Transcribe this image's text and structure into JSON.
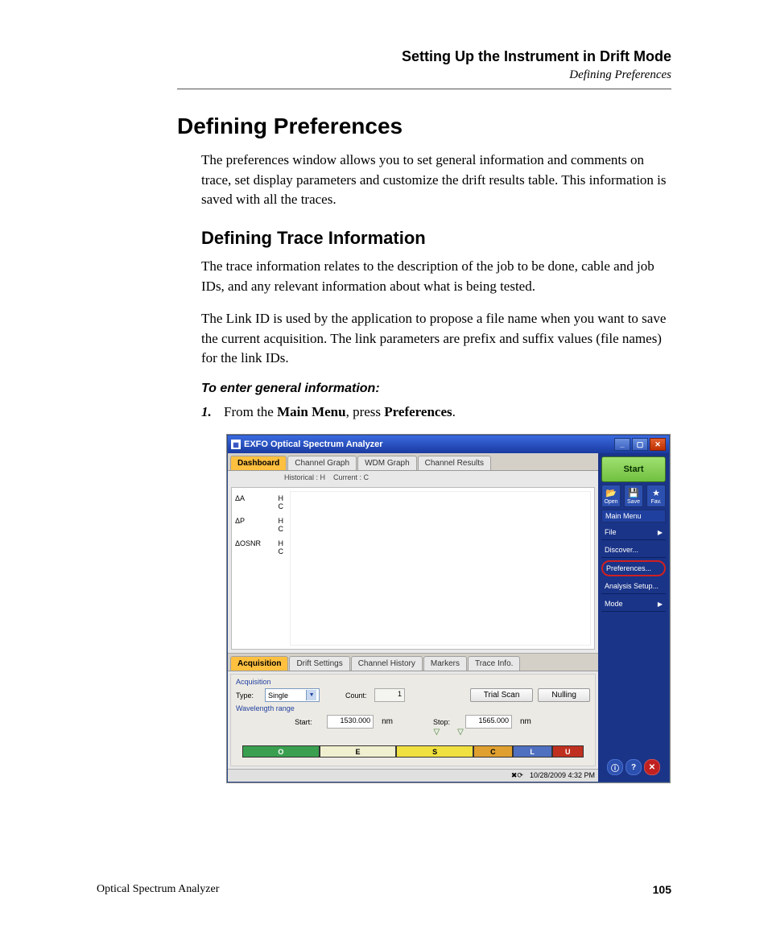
{
  "header": {
    "chapter": "Setting Up the Instrument in Drift Mode",
    "subchapter": "Defining Preferences"
  },
  "section_title": "Defining Preferences",
  "para1": "The preferences window allows you to set general information and comments on trace, set display parameters and customize the drift results table. This information is saved with all the traces.",
  "subsection_title": "Defining Trace Information",
  "para2": "The trace information relates to the description of the job to be done, cable and job IDs, and any relevant information about what is being tested.",
  "para3": "The Link ID is used by the application to propose a file name when you want to save the current acquisition. The link parameters are prefix and suffix values (file names) for the link IDs.",
  "instruction": "To enter general information:",
  "step1_num": "1.",
  "step1_pre": "From the ",
  "step1_b1": "Main Menu",
  "step1_mid": ", press ",
  "step1_b2": "Preferences",
  "step1_post": ".",
  "app": {
    "title": "EXFO Optical Spectrum Analyzer",
    "top_tabs": {
      "dashboard": "Dashboard",
      "channel_graph": "Channel Graph",
      "wdm_graph": "WDM Graph",
      "channel_results": "Channel Results"
    },
    "legend": {
      "hist": "Historical : H",
      "curr": "Current : C"
    },
    "rows": {
      "da": "ΔA",
      "dp": "ΔP",
      "dosnr": "ΔOSNR",
      "h": "H",
      "c": "C"
    },
    "bottom_tabs": {
      "acq": "Acquisition",
      "drift": "Drift Settings",
      "hist": "Channel History",
      "markers": "Markers",
      "trace": "Trace Info."
    },
    "acq": {
      "group1": "Acquisition",
      "type_lbl": "Type:",
      "type_val": "Single",
      "count_lbl": "Count:",
      "count_val": "1",
      "trial": "Trial Scan",
      "nulling": "Nulling",
      "group2": "Wavelength range",
      "start_lbl": "Start:",
      "start_val": "1530.000",
      "stop_lbl": "Stop:",
      "stop_val": "1565.000",
      "nm": "nm"
    },
    "bands": {
      "O": "O",
      "E": "E",
      "S": "S",
      "C": "C",
      "L": "L",
      "U": "U"
    },
    "side": {
      "start": "Start",
      "open": "Open",
      "save": "Save",
      "fav": "Fav.",
      "main_menu": "Main Menu",
      "file": "File",
      "discover": "Discover...",
      "preferences": "Preferences...",
      "analysis": "Analysis Setup...",
      "mode": "Mode"
    },
    "status": {
      "time": "10/28/2009 4:32 PM"
    }
  },
  "footer": {
    "book": "Optical Spectrum Analyzer",
    "page": "105"
  }
}
